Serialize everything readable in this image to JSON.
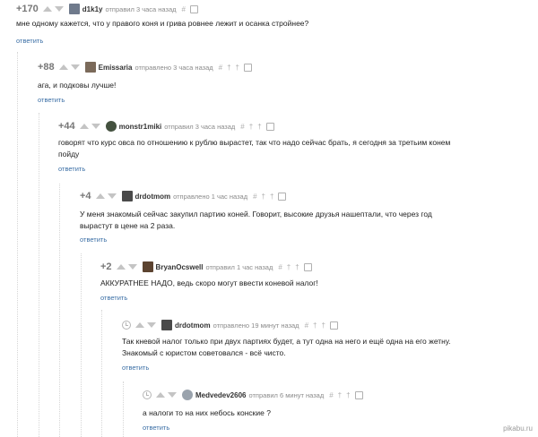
{
  "comments": [
    {
      "rating": "+170",
      "user": "d1k1y",
      "meta": "отправил 3 часа назад",
      "text": "мне одному кажется, что у правого коня и грива ровнее лежит и осанка стройнее?",
      "reply": "ответить"
    },
    {
      "rating": "+88",
      "user": "Emissaria",
      "meta": "отправлено 3 часа назад",
      "text": "ага, и подковы лучше!",
      "reply": "ответить"
    },
    {
      "rating": "+44",
      "user": "monstr1miki",
      "meta": "отправил 3 часа назад",
      "text_lines": [
        "говорят что курс овса по отношению к рублю вырастет, так что надо сейчас брать, я сегодня за третьим конем",
        "пойду"
      ],
      "reply": "ответить"
    },
    {
      "rating": "+4",
      "user": "drdotmom",
      "meta": "отправлено 1 час назад",
      "text_lines": [
        "У меня знакомый сейчас закупил партию коней. Говорит, высокие друзья нашептали, что через год",
        "вырастут в цене на 2 раза."
      ],
      "reply": "ответить"
    },
    {
      "rating": "+2",
      "user": "BryanOcswell",
      "meta": "отправил 1 час назад",
      "text": "АККУРАТНЕЕ НАДО, ведь скоро могут ввести коневой налог!",
      "reply": "ответить"
    },
    {
      "user": "drdotmom",
      "meta": "отправлено 19 минут назад",
      "text_lines": [
        "Так кневой налог только при двух партиях будет, а тут одна на него и ещё одна на его жетну.",
        "Знакомый с юристом советовался - всё чисто."
      ],
      "reply": "ответить"
    },
    {
      "user": "Medvedev2606",
      "meta": "отправил 6 минут назад",
      "text": "а налоги то на них небось конские ?",
      "reply": "ответить"
    }
  ],
  "icons": {
    "link": "#",
    "pin": "†",
    "bookmark": "⎘"
  },
  "watermark": "pikabu.ru",
  "colors": {
    "reply_link": "#3a6ea5",
    "rating": "#777777",
    "meta": "#8a8a8a"
  }
}
